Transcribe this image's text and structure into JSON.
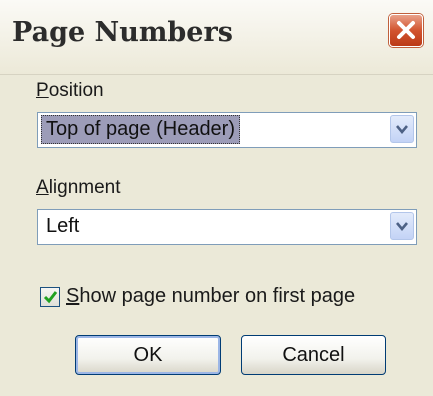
{
  "window": {
    "title": "Page Numbers",
    "close_icon": "close-x-icon"
  },
  "position": {
    "label_accel": "P",
    "label_rest": "osition",
    "value": "Top of page (Header)",
    "dropdown_icon": "chevron-down-icon"
  },
  "alignment": {
    "label_accel": "A",
    "label_rest": "lignment",
    "value": "Left",
    "dropdown_icon": "chevron-down-icon"
  },
  "first_page": {
    "checked": true,
    "label_accel": "S",
    "label_rest": "how page number on first page",
    "check_icon": "checkmark-icon"
  },
  "buttons": {
    "ok": "OK",
    "cancel": "Cancel"
  },
  "colors": {
    "dialog_bg": "#ebe9d8",
    "close_red": "#d2542f",
    "selection": "#9c9cb8",
    "check_green": "#21a121"
  }
}
